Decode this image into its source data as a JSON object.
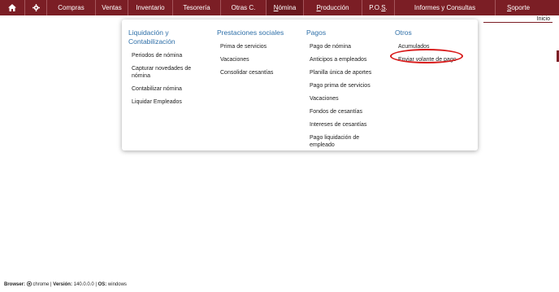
{
  "nav": {
    "home_icon": "home-icon",
    "gear_icon": "gear-icon",
    "items": [
      {
        "label": "Compras"
      },
      {
        "label": "Ventas"
      },
      {
        "label": "Inventario"
      },
      {
        "label": "Tesorería"
      },
      {
        "label": "Otras C."
      },
      {
        "label": "Nómina",
        "prefix": "",
        "underline": "N",
        "suffix": "ómina"
      },
      {
        "label": "Producción",
        "prefix": "",
        "underline": "P",
        "suffix": "roducción"
      },
      {
        "label": "P.O.S.",
        "prefix": "P.O.",
        "underline": "S",
        "suffix": "."
      },
      {
        "label": "Informes y Consultas"
      },
      {
        "label": "Soporte",
        "prefix": "",
        "underline": "S",
        "suffix": "oporte"
      }
    ]
  },
  "breadcrumb": "Inicio",
  "menu": {
    "liquidacion": {
      "title": "Liquidación y Contabilización",
      "items": [
        "Periodos de nómina",
        "Capturar novedades de nómina",
        "Contabilizar nómina",
        "Liquidar Empleados"
      ]
    },
    "prestaciones": {
      "title": "Prestaciones sociales",
      "items": [
        "Prima de servicios",
        "Vacaciones",
        "Consolidar cesantías"
      ]
    },
    "pagos": {
      "title": "Pagos",
      "items": [
        "Pago de nómina",
        "Anticipos a empleados",
        "Planilla única de aportes",
        "Pago prima de servicios",
        "Vacaciones",
        "Fondos de cesantías",
        "Intereses de cesantías",
        "Pago liquidación de empleado"
      ]
    },
    "otros": {
      "title": "Otros",
      "items": [
        "Acumulados",
        "Enviar volante de pago"
      ]
    }
  },
  "footer": {
    "browser_label": "Browser:",
    "browser_value": "chrome",
    "version_label": "Versión:",
    "version_value": "140.0.0.0",
    "os_label": "OS:",
    "os_value": "windows"
  },
  "colors": {
    "nav_bg": "#7b1e25",
    "menu_title": "#2e6fa8",
    "highlight": "#d81b1b"
  }
}
